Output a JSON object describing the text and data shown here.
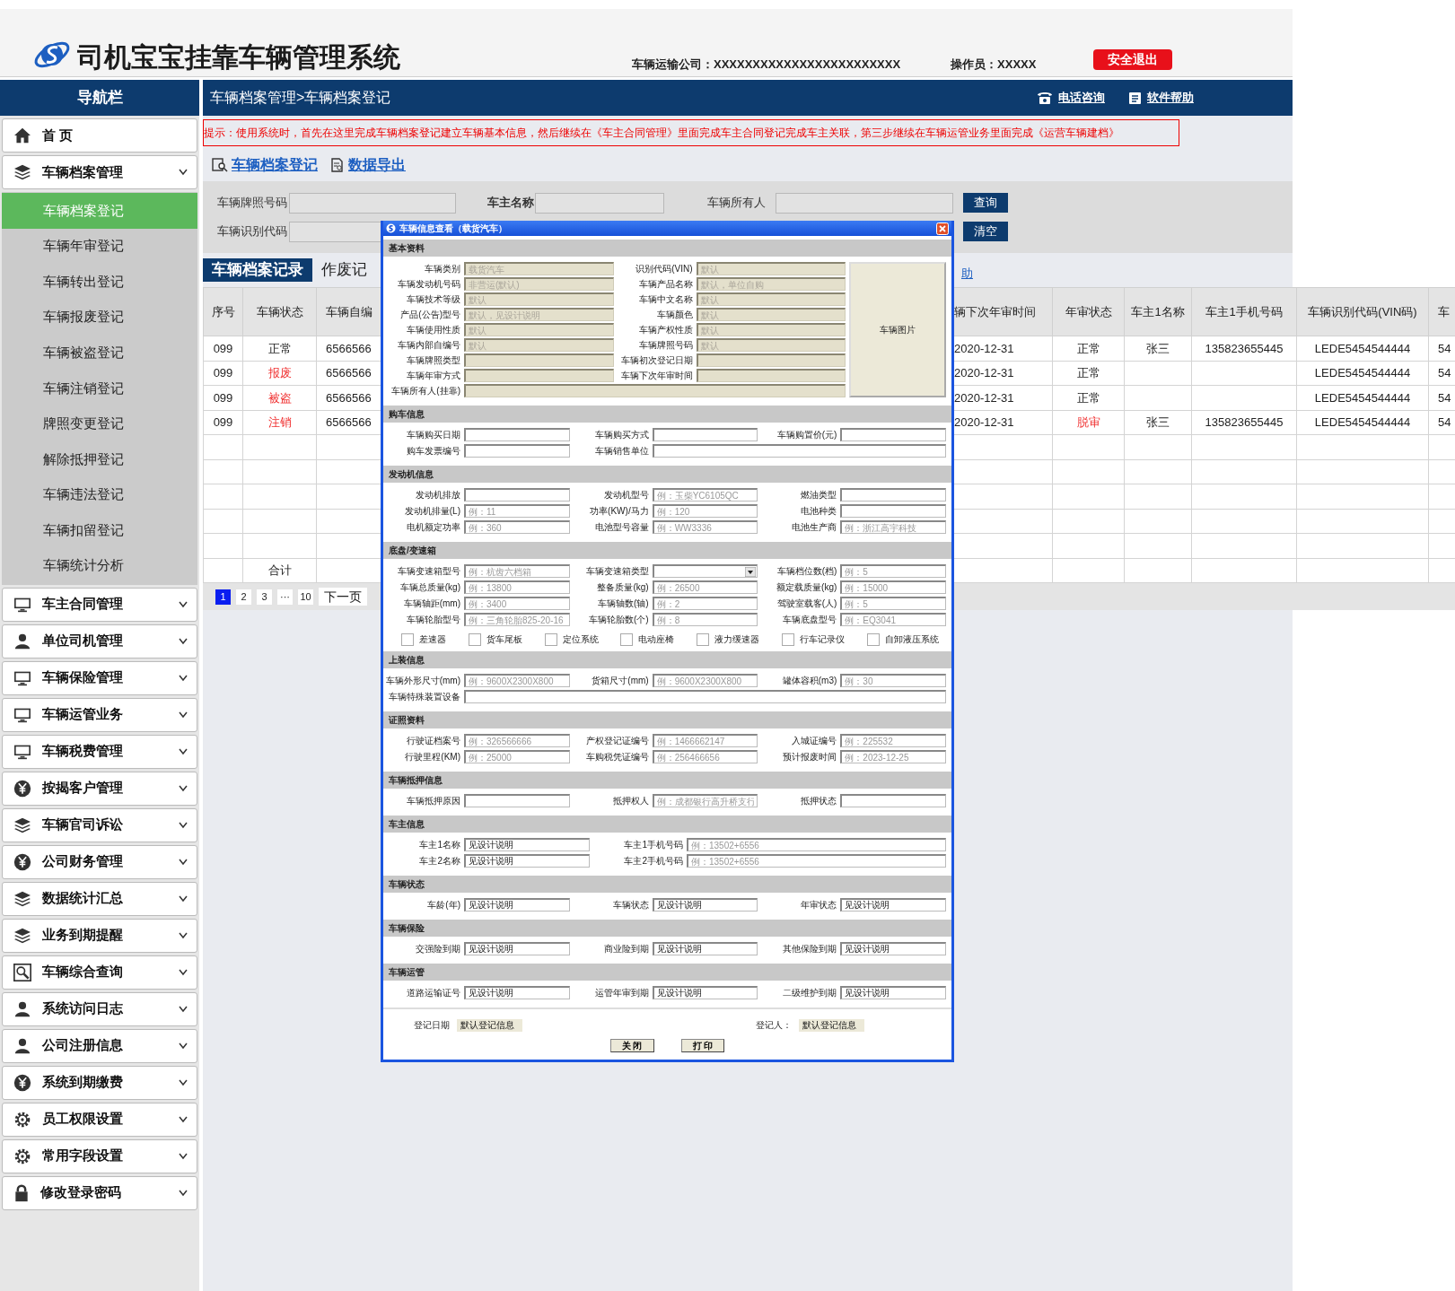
{
  "header": {
    "title": "司机宝宝挂靠车辆管理系统",
    "company": "车辆运输公司：XXXXXXXXXXXXXXXXXXXXXXXX",
    "operator": "操作员：XXXXX",
    "logout": "安全退出"
  },
  "nav_title": "导航栏",
  "breadcrumb": "车辆档案管理>车辆档案登记",
  "top_links": [
    "电话咨询",
    "软件帮助"
  ],
  "sidebar": {
    "items": [
      {
        "label": "首 页",
        "kind": "home"
      },
      {
        "label": "车辆档案管理",
        "kind": "menu",
        "children": [
          {
            "label": "车辆档案登记",
            "selected": true
          },
          {
            "label": "车辆年审登记",
            "selected": false
          },
          {
            "label": "车辆转出登记",
            "selected": false
          },
          {
            "label": "车辆报废登记",
            "selected": false
          },
          {
            "label": "车辆被盗登记",
            "selected": false
          },
          {
            "label": "车辆注销登记",
            "selected": false
          },
          {
            "label": "牌照变更登记",
            "selected": false
          },
          {
            "label": "解除抵押登记",
            "selected": false
          },
          {
            "label": "车辆违法登记",
            "selected": false
          },
          {
            "label": "车辆扣留登记",
            "selected": false
          },
          {
            "label": "车辆统计分析",
            "selected": false
          }
        ]
      },
      {
        "label": "车主合同管理",
        "kind": "menu"
      },
      {
        "label": "单位司机管理",
        "kind": "menu"
      },
      {
        "label": "车辆保险管理",
        "kind": "menu"
      },
      {
        "label": "车辆运管业务",
        "kind": "menu"
      },
      {
        "label": "车辆税费管理",
        "kind": "menu"
      },
      {
        "label": "按揭客户管理",
        "kind": "menu"
      },
      {
        "label": "车辆官司诉讼",
        "kind": "menu"
      },
      {
        "label": "公司财务管理",
        "kind": "menu"
      },
      {
        "label": "数据统计汇总",
        "kind": "menu"
      },
      {
        "label": "业务到期提醒",
        "kind": "menu"
      },
      {
        "label": "车辆综合查询",
        "kind": "menu"
      },
      {
        "label": "系统访问日志",
        "kind": "menu"
      },
      {
        "label": "公司注册信息",
        "kind": "menu"
      },
      {
        "label": "系统到期缴费",
        "kind": "menu"
      },
      {
        "label": "员工权限设置",
        "kind": "menu"
      },
      {
        "label": "常用字段设置",
        "kind": "menu"
      },
      {
        "label": "修改登录密码",
        "kind": "menu"
      }
    ]
  },
  "hint": "提示：使用系统时，首先在这里完成车辆档案登记建立车辆基本信息，然后继续在《车主合同管理》里面完成车主合同登记完成车主关联，第三步继续在车辆运管业务里面完成《运营车辆建档》",
  "actions": [
    "车辆档案登记",
    "数据导出"
  ],
  "filters": {
    "row1": [
      {
        "label": "车辆牌照号码"
      },
      {
        "label": "车主名称"
      },
      {
        "label": "车辆所有人"
      }
    ],
    "row2": [
      {
        "label": "车辆识别代码"
      }
    ],
    "buttons": [
      "查询",
      "清空"
    ]
  },
  "tabs": [
    {
      "label": "车辆档案记录",
      "selected": true
    },
    {
      "label": "作废记",
      "selected": false
    }
  ],
  "side_link": "助",
  "table": {
    "columns": [
      "序号",
      "车辆状态",
      "车辆自编",
      "辆下次年审时间",
      "年审状态",
      "车主1名称",
      "车主1手机号码",
      "车辆识别代码(VIN码)",
      "车"
    ],
    "rows": [
      {
        "no": "099",
        "status": "正常",
        "status_alert": false,
        "code": "6566566",
        "next_review": "2020-12-31",
        "review": "正常",
        "review_alert": false,
        "owner": "张三",
        "phone": "135823655445",
        "vin": "LEDE5454544444",
        "column_9": "54"
      },
      {
        "no": "099",
        "status": "报废",
        "status_alert": true,
        "code": "6566566",
        "next_review": "2020-12-31",
        "review": "正常",
        "review_alert": false,
        "vin": "LEDE5454544444",
        "column_9": "54"
      },
      {
        "no": "099",
        "status": "被盗",
        "status_alert": true,
        "code": "6566566",
        "next_review": "2020-12-31",
        "review": "正常",
        "review_alert": false,
        "vin": "LEDE5454544444",
        "column_9": "54"
      },
      {
        "no": "099",
        "status": "注销",
        "status_alert": true,
        "code": "6566566",
        "next_review": "2020-12-31",
        "review": "脱审",
        "review_alert": true,
        "owner": "张三",
        "phone": "135823655445",
        "vin": "LEDE5454544444",
        "column_9": "54"
      }
    ],
    "total_label": "合计"
  },
  "pager": {
    "pages": [
      {
        "label": "1",
        "selected": true
      },
      {
        "label": "2",
        "selected": false
      },
      {
        "label": "3",
        "selected": false
      },
      {
        "label": "···",
        "selected": false
      },
      {
        "label": "10",
        "selected": false
      }
    ],
    "next": "下一页"
  },
  "modal": {
    "title": "车辆信息查看（载货汽车）",
    "sections": [
      {
        "title": "基本资料",
        "kind": "basic",
        "photo": "车辆图片",
        "fields": [
          {
            "label": "车辆类别",
            "placeholder": "载货汽车",
            "disabled": true
          },
          {
            "label": "识别代码(VIN)",
            "placeholder": "默认",
            "disabled": true
          },
          {
            "label": "车辆发动机号码",
            "placeholder": "非营运(默认)",
            "disabled": true
          },
          {
            "label": "车辆产品名称",
            "placeholder": "默认，单位自购",
            "disabled": true
          },
          {
            "label": "车辆技术等级",
            "placeholder": "默认",
            "disabled": true
          },
          {
            "label": "车辆中文名称",
            "placeholder": "默认",
            "disabled": true
          },
          {
            "label": "产品(公告)型号",
            "placeholder": "默认，见设计说明",
            "disabled": true
          },
          {
            "label": "车辆颜色",
            "placeholder": "默认",
            "disabled": true
          },
          {
            "label": "车辆使用性质",
            "placeholder": "默认",
            "disabled": true
          },
          {
            "label": "车辆产权性质",
            "placeholder": "默认",
            "disabled": true
          },
          {
            "label": "车辆内部自编号",
            "placeholder": "默认",
            "disabled": true
          },
          {
            "label": "车辆牌照号码",
            "placeholder": "默认",
            "disabled": true
          },
          {
            "label": "车辆牌照类型",
            "disabled": true
          },
          {
            "label": "车辆初次登记日期",
            "disabled": true
          },
          {
            "label": "车辆年审方式",
            "disabled": true
          },
          {
            "label": "车辆下次年审时间",
            "disabled": true
          },
          {
            "label": "车辆所有人(挂靠)",
            "disabled": true,
            "wide": true
          }
        ]
      },
      {
        "title": "购车信息",
        "kind": "triple",
        "fields": [
          {
            "label": "车辆购买日期",
            "disabled": false
          },
          {
            "label": "车辆购买方式",
            "disabled": false
          },
          {
            "label": "车辆购置价(元)",
            "disabled": false
          },
          {
            "label": "购车发票编号",
            "disabled": false
          },
          {
            "label": "车辆销售单位",
            "disabled": false,
            "wide": true
          }
        ]
      },
      {
        "title": "发动机信息",
        "kind": "triple",
        "fields": [
          {
            "label": "发动机排放",
            "disabled": false
          },
          {
            "label": "发动机型号",
            "placeholder": "例：玉柴YC6105QC",
            "disabled": false
          },
          {
            "label": "燃油类型",
            "disabled": false
          },
          {
            "label": "发动机排量(L)",
            "placeholder": "例：11",
            "disabled": false
          },
          {
            "label": "功率(KW)/马力",
            "placeholder": "例：120",
            "disabled": false
          },
          {
            "label": "电池种类",
            "disabled": false
          },
          {
            "label": "电机额定功率",
            "placeholder": "例：360",
            "disabled": false
          },
          {
            "label": "电池型号容量",
            "placeholder": "例：WW3336",
            "disabled": false
          },
          {
            "label": "电池生产商",
            "placeholder": "例：浙江高宇科技",
            "disabled": false
          }
        ]
      },
      {
        "title": "底盘/变速箱",
        "kind": "triple",
        "fields": [
          {
            "label": "车辆变速箱型号",
            "placeholder": "例：杭齿六档箱",
            "disabled": false
          },
          {
            "label": "车辆变速箱类型",
            "kind": "select"
          },
          {
            "label": "车辆档位数(档)",
            "placeholder": "例：5",
            "disabled": false
          },
          {
            "label": "车辆总质量(kg)",
            "placeholder": "例：13800",
            "disabled": false
          },
          {
            "label": "整备质量(kg)",
            "placeholder": "例：26500",
            "disabled": false
          },
          {
            "label": "额定载质量(kg)",
            "placeholder": "例：15000",
            "disabled": false
          },
          {
            "label": "车辆轴距(mm)",
            "placeholder": "例：3400",
            "disabled": false
          },
          {
            "label": "车辆轴数(轴)",
            "placeholder": "例：2",
            "disabled": false
          },
          {
            "label": "驾驶室载客(人)",
            "placeholder": "例：5",
            "disabled": false
          },
          {
            "label": "车辆轮胎型号",
            "placeholder": "例：三角轮胎825-20-16",
            "disabled": false
          },
          {
            "label": "车辆轮胎数(个)",
            "placeholder": "例：8",
            "disabled": false
          },
          {
            "label": "车辆底盘型号",
            "placeholder": "例：EQ3041",
            "disabled": false
          }
        ],
        "checkboxes": [
          {
            "label": "差速器",
            "checked": false
          },
          {
            "label": "货车尾板",
            "checked": false
          },
          {
            "label": "定位系统",
            "checked": false
          },
          {
            "label": "电动座椅",
            "checked": false
          },
          {
            "label": "液力缓速器",
            "checked": false
          },
          {
            "label": "行车记录仪",
            "checked": false
          },
          {
            "label": "自卸液压系统",
            "checked": false
          }
        ]
      },
      {
        "title": "上装信息",
        "kind": "triple",
        "fields": [
          {
            "label": "车辆外形尺寸(mm)",
            "placeholder": "例：9600X2300X800",
            "disabled": false
          },
          {
            "label": "货箱尺寸(mm)",
            "placeholder": "例：9600X2300X800",
            "disabled": false
          },
          {
            "label": "罐体容积(m3)",
            "placeholder": "例：30",
            "disabled": false
          },
          {
            "label": "车辆特殊装置设备",
            "disabled": false,
            "wide": true
          }
        ]
      },
      {
        "title": "证照资料",
        "kind": "triple",
        "fields": [
          {
            "label": "行驶证档案号",
            "placeholder": "例：326566666",
            "disabled": false
          },
          {
            "label": "产权登记证编号",
            "placeholder": "例：1466662147",
            "disabled": false
          },
          {
            "label": "入城证编号",
            "placeholder": "例：225532",
            "disabled": false
          },
          {
            "label": "行驶里程(KM)",
            "placeholder": "例：25000",
            "disabled": false
          },
          {
            "label": "车购税凭证编号",
            "placeholder": "例：256466656",
            "disabled": false
          },
          {
            "label": "预计报废时间",
            "placeholder": "例：2023-12-25",
            "disabled": false
          }
        ]
      },
      {
        "title": "车辆抵押信息",
        "kind": "triple",
        "fields": [
          {
            "label": "车辆抵押原因",
            "disabled": false
          },
          {
            "label": "抵押权人",
            "placeholder": "例：成都银行高升桥支行",
            "disabled": false
          },
          {
            "label": "抵押状态",
            "disabled": false
          }
        ]
      },
      {
        "title": "车主信息",
        "kind": "pair",
        "fields": [
          {
            "label": "车主1名称",
            "value": "见设计说明",
            "disabled": false
          },
          {
            "label": "车主1手机号码",
            "placeholder": "例：13502+6556",
            "disabled": false
          },
          {
            "label": "车主2名称",
            "value": "见设计说明",
            "disabled": false
          },
          {
            "label": "车主2手机号码",
            "placeholder": "例：13502+6556",
            "disabled": false
          }
        ]
      },
      {
        "title": "车辆状态",
        "kind": "triple",
        "fields": [
          {
            "label": "车龄(年)",
            "value": "见设计说明",
            "disabled": false
          },
          {
            "label": "车辆状态",
            "value": "见设计说明",
            "disabled": false
          },
          {
            "label": "年审状态",
            "value": "见设计说明",
            "disabled": false
          }
        ]
      },
      {
        "title": "车辆保险",
        "kind": "triple",
        "fields": [
          {
            "label": "交强险到期",
            "value": "见设计说明",
            "disabled": false
          },
          {
            "label": "商业险到期",
            "value": "见设计说明",
            "disabled": false
          },
          {
            "label": "其他保险到期",
            "value": "见设计说明",
            "disabled": false
          }
        ]
      },
      {
        "title": "车辆运管",
        "kind": "triple",
        "fields": [
          {
            "label": "道路运输证号",
            "value": "见设计说明",
            "disabled": false
          },
          {
            "label": "运管年审到期",
            "value": "见设计说明",
            "disabled": false
          },
          {
            "label": "二级维护到期",
            "value": "见设计说明",
            "disabled": false
          }
        ]
      }
    ],
    "footer": {
      "fields": [
        {
          "label": "登记日期",
          "value": "默认登记信息",
          "disabled": true
        },
        {
          "label": "登记人：",
          "value": "默认登记信息",
          "disabled": true
        }
      ],
      "buttons": [
        "关 闭",
        "打 印"
      ]
    }
  }
}
